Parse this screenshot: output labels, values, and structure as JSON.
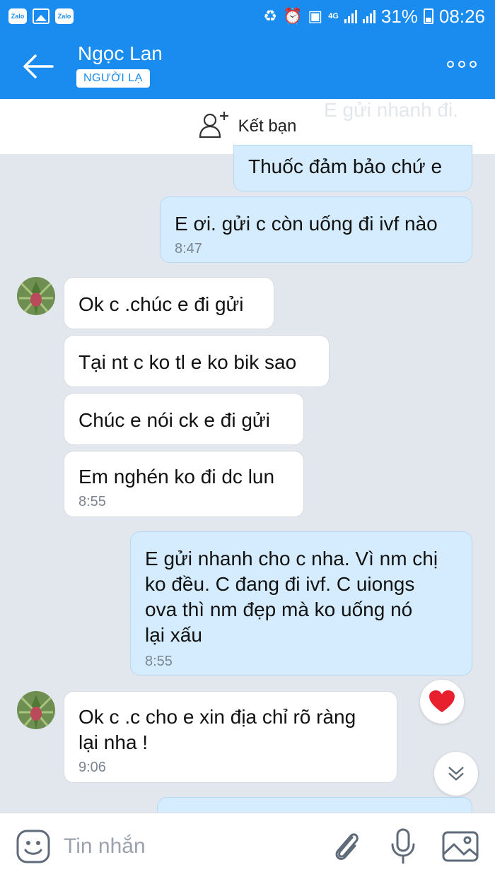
{
  "status_bar": {
    "app_icons": [
      "Zalo",
      "Zalo"
    ],
    "network": "4G",
    "battery": "31%",
    "time": "08:26"
  },
  "header": {
    "name": "Ngọc Lan",
    "badge": "NGƯỜI LẠ"
  },
  "friend_bar": {
    "label": "Kết bạn",
    "ghost_text": "E gửi nhanh đi."
  },
  "messages": [
    {
      "dir": "out",
      "lines": [
        "Thuốc đảm bảo chứ e"
      ],
      "time": ""
    },
    {
      "dir": "out",
      "lines": [
        "E ơi. gửi c còn uống đi ivf nào"
      ],
      "time": "8:47"
    },
    {
      "dir": "in",
      "lines": [
        "Ok c .chúc e đi gửi"
      ],
      "time": ""
    },
    {
      "dir": "in",
      "lines": [
        "Tại nt c ko tl e ko bik sao"
      ],
      "time": ""
    },
    {
      "dir": "in",
      "lines": [
        "Chúc e nói ck e đi gửi"
      ],
      "time": ""
    },
    {
      "dir": "in",
      "lines": [
        "Em nghén ko đi dc lun"
      ],
      "time": "8:55"
    },
    {
      "dir": "out",
      "lines": [
        "E gửi nhanh cho c nha. Vì nm chị",
        "ko đều. C đang đi ivf. C uiongs",
        "ova thì nm đẹp mà ko uống nó",
        "lại xấu"
      ],
      "time": "8:55"
    },
    {
      "dir": "in",
      "lines": [
        "Ok c .c cho e xin địa chỉ rõ ràng",
        "lại nha !"
      ],
      "time": "9:06"
    }
  ],
  "input": {
    "placeholder": "Tin nhắn"
  },
  "icons": {
    "back": "back-arrow-icon",
    "more": "more-options-icon",
    "add_friend": "add-friend-icon",
    "reaction": "heart-icon",
    "scroll": "chevron-double-down-icon",
    "emoji": "emoji-icon",
    "attach": "paperclip-icon",
    "mic": "microphone-icon",
    "image": "image-icon"
  },
  "colors": {
    "header": "#1a8cf0",
    "outgoing_bubble": "#d4ecfd",
    "incoming_bubble": "#ffffff",
    "background": "#e2e7ee",
    "heart": "#e8202e"
  }
}
